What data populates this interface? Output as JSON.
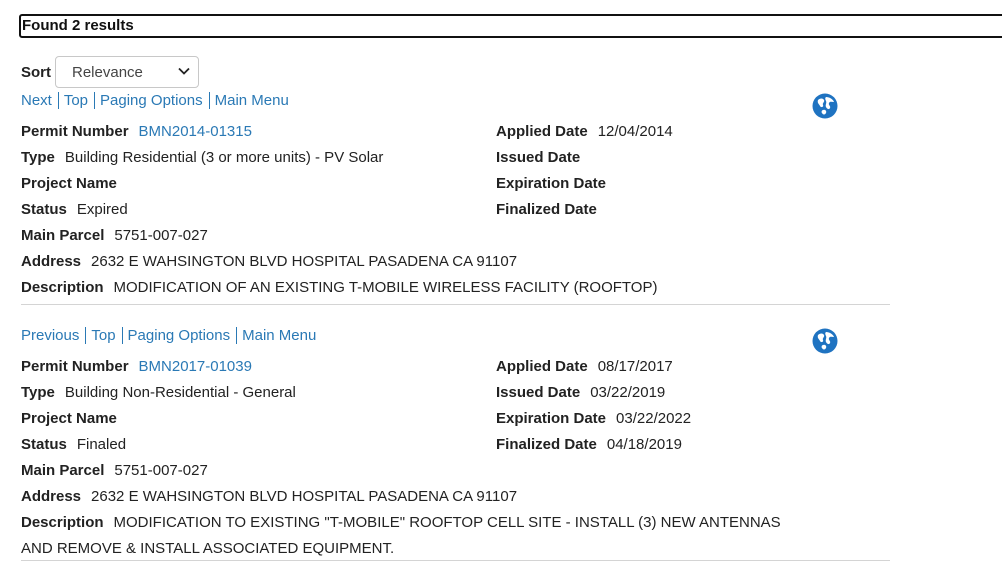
{
  "results_summary": "Found 2 results",
  "sort": {
    "label": "Sort",
    "selected": "Relevance"
  },
  "results": [
    {
      "nav": [
        {
          "label": "Next"
        },
        {
          "label": "Top"
        },
        {
          "label": "Paging Options"
        },
        {
          "label": "Main Menu"
        }
      ],
      "icon": "globe-icon",
      "permit_number_label": "Permit Number",
      "permit_number": "BMN2014-01315",
      "type_label": "Type",
      "type": "Building Residential (3 or more units) - PV Solar",
      "project_name_label": "Project Name",
      "project_name": "",
      "status_label": "Status",
      "status": "Expired",
      "main_parcel_label": "Main Parcel",
      "main_parcel": "5751-007-027",
      "address_label": "Address",
      "address": "2632 E WAHSINGTON BLVD HOSPITAL PASADENA CA 91107",
      "description_label": "Description",
      "description": "MODIFICATION OF AN EXISTING T-MOBILE WIRELESS FACILITY (ROOFTOP)",
      "applied_date_label": "Applied Date",
      "applied_date": "12/04/2014",
      "issued_date_label": "Issued Date",
      "issued_date": "",
      "expiration_date_label": "Expiration Date",
      "expiration_date": "",
      "finalized_date_label": "Finalized Date",
      "finalized_date": ""
    },
    {
      "nav": [
        {
          "label": "Previous"
        },
        {
          "label": "Top"
        },
        {
          "label": "Paging Options"
        },
        {
          "label": "Main Menu"
        }
      ],
      "icon": "globe-icon",
      "permit_number_label": "Permit Number",
      "permit_number": "BMN2017-01039",
      "type_label": "Type",
      "type": "Building Non-Residential - General",
      "project_name_label": "Project Name",
      "project_name": "",
      "status_label": "Status",
      "status": "Finaled",
      "main_parcel_label": "Main Parcel",
      "main_parcel": "5751-007-027",
      "address_label": "Address",
      "address": "2632 E WAHSINGTON BLVD HOSPITAL PASADENA CA 91107",
      "description_label": "Description",
      "description": "MODIFICATION TO EXISTING \"T-MOBILE\" ROOFTOP CELL SITE - INSTALL (3) NEW ANTENNAS AND REMOVE & INSTALL ASSOCIATED EQUIPMENT.",
      "applied_date_label": "Applied Date",
      "applied_date": "08/17/2017",
      "issued_date_label": "Issued Date",
      "issued_date": "03/22/2019",
      "expiration_date_label": "Expiration Date",
      "expiration_date": "03/22/2022",
      "finalized_date_label": "Finalized Date",
      "finalized_date": "04/18/2019"
    }
  ],
  "colors": {
    "link": "#2a79b5",
    "globe": "#1f73c1",
    "divider": "#d4d4d4"
  }
}
